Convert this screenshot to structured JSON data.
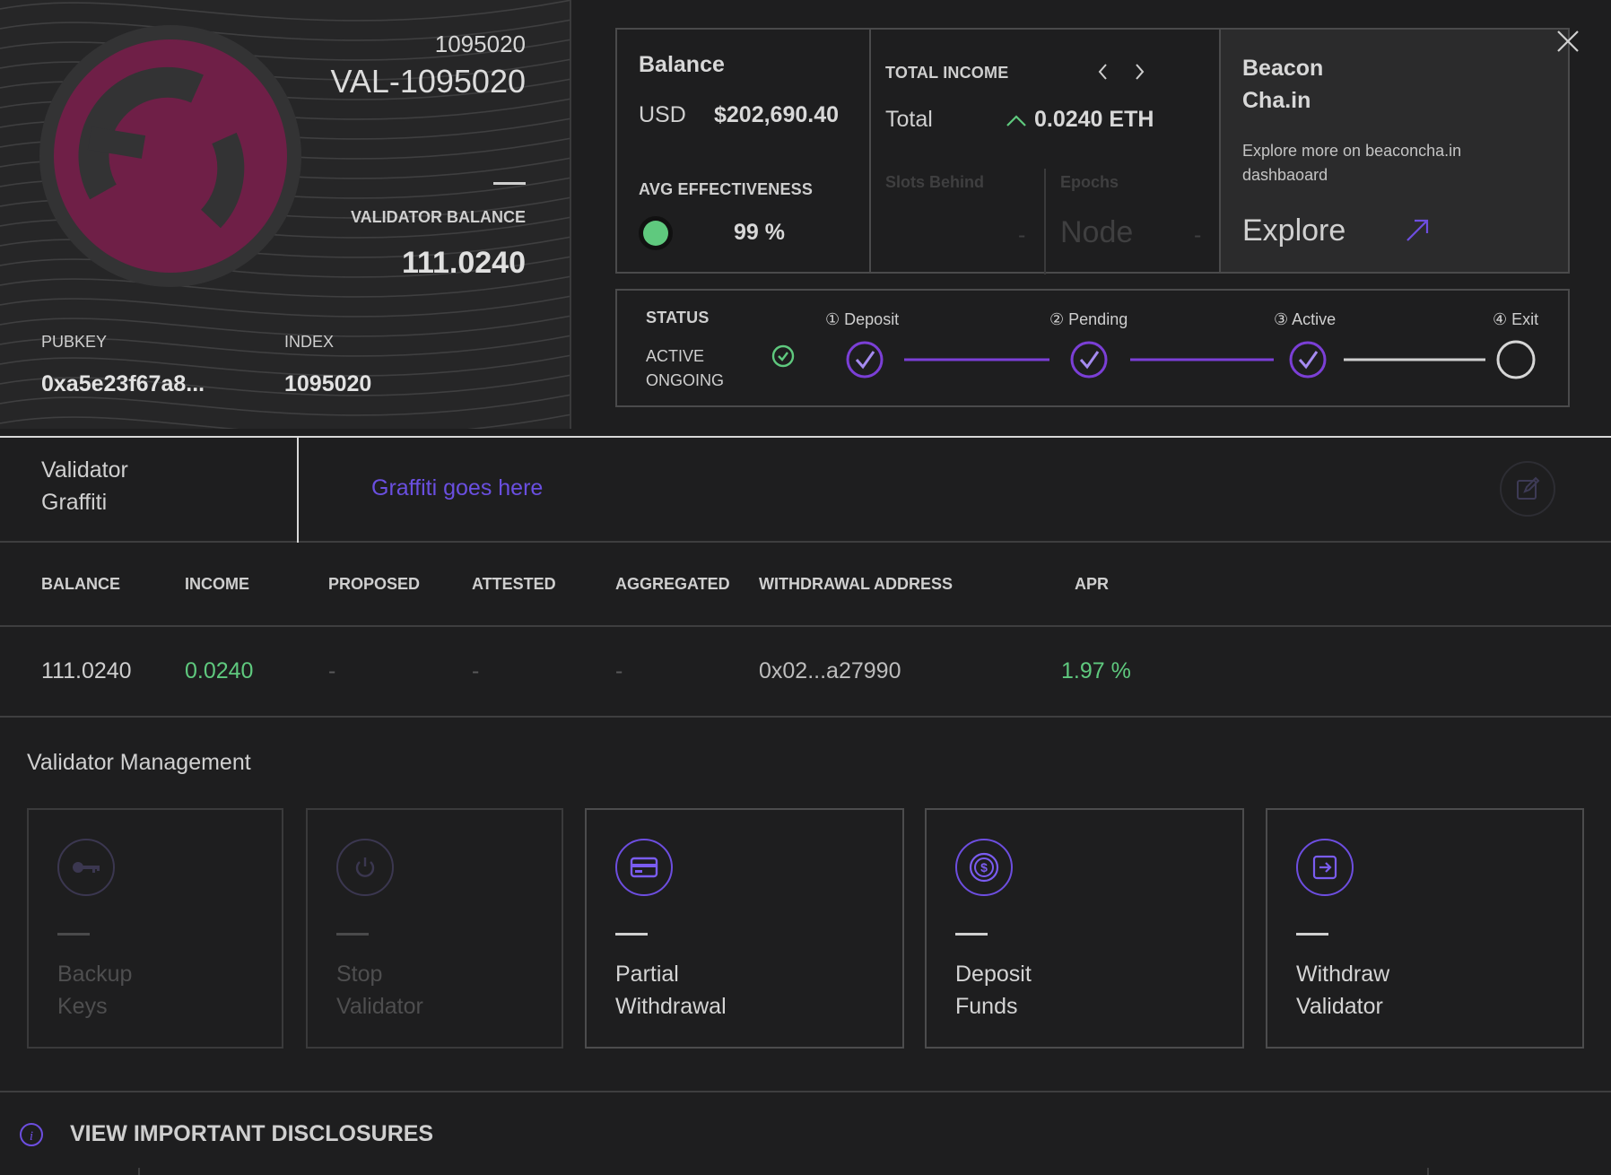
{
  "card": {
    "index_number": "1095020",
    "validator_name": "VAL-1095020",
    "balance_label": "VALIDATOR BALANCE",
    "balance_value": "111.0240",
    "pubkey_label": "PUBKEY",
    "pubkey_value": "0xa5e23f67a8...",
    "index_label": "INDEX",
    "index_value": "1095020"
  },
  "balance": {
    "title": "Balance",
    "currency": "USD",
    "value": "$202,690.40",
    "avg_label": "AVG EFFECTIVENESS",
    "avg_value": "99 %"
  },
  "income": {
    "title": "TOTAL INCOME",
    "total_label": "Total",
    "total_value": "0.0240 ETH",
    "slots_label": "Slots Behind",
    "slots_value": "-",
    "epochs_label": "Epochs",
    "epochs_node": "Node",
    "epochs_value": "-"
  },
  "beacon": {
    "title_line1": "Beacon",
    "title_line2": "Cha.in",
    "desc_line1": "Explore more on beaconcha.in",
    "desc_line2": "dashbaoard",
    "explore_label": "Explore"
  },
  "status": {
    "title": "STATUS",
    "state_line1": "ACTIVE",
    "state_line2": "ONGOING",
    "steps": [
      {
        "num": "①",
        "label": "Deposit"
      },
      {
        "num": "②",
        "label": "Pending"
      },
      {
        "num": "③",
        "label": "Active"
      },
      {
        "num": "④",
        "label": "Exit"
      }
    ]
  },
  "graffiti": {
    "label_line1": "Validator",
    "label_line2": "Graffiti",
    "value": "Graffiti goes here"
  },
  "table": {
    "headers": [
      "BALANCE",
      "INCOME",
      "PROPOSED",
      "ATTESTED",
      "AGGREGATED",
      "WITHDRAWAL ADDRESS",
      "APR"
    ],
    "row": [
      "111.0240",
      "0.0240",
      "-",
      "-",
      "-",
      "0x02...a27990",
      "1.97 %"
    ]
  },
  "management": {
    "title": "Validator Management",
    "actions": [
      {
        "line1": "Backup",
        "line2": "Keys",
        "icon": "key-icon",
        "enabled": false
      },
      {
        "line1": "Stop",
        "line2": "Validator",
        "icon": "power-icon",
        "enabled": false
      },
      {
        "line1": "Partial",
        "line2": "Withdrawal",
        "icon": "credit-card-icon",
        "enabled": true
      },
      {
        "line1": "Deposit",
        "line2": "Funds",
        "icon": "dollar-coin-icon",
        "enabled": true
      },
      {
        "line1": "Withdraw",
        "line2": "Validator",
        "icon": "exit-arrow-icon",
        "enabled": true
      }
    ]
  },
  "footer": {
    "disclosures_label": "VIEW IMPORTANT DISCLOSURES"
  },
  "colors": {
    "accent": "#6d4ee0",
    "accent_link": "#5b43d6",
    "green": "#5fc97e",
    "avatar": "#6f1f47",
    "background": "#1e1e1f"
  }
}
